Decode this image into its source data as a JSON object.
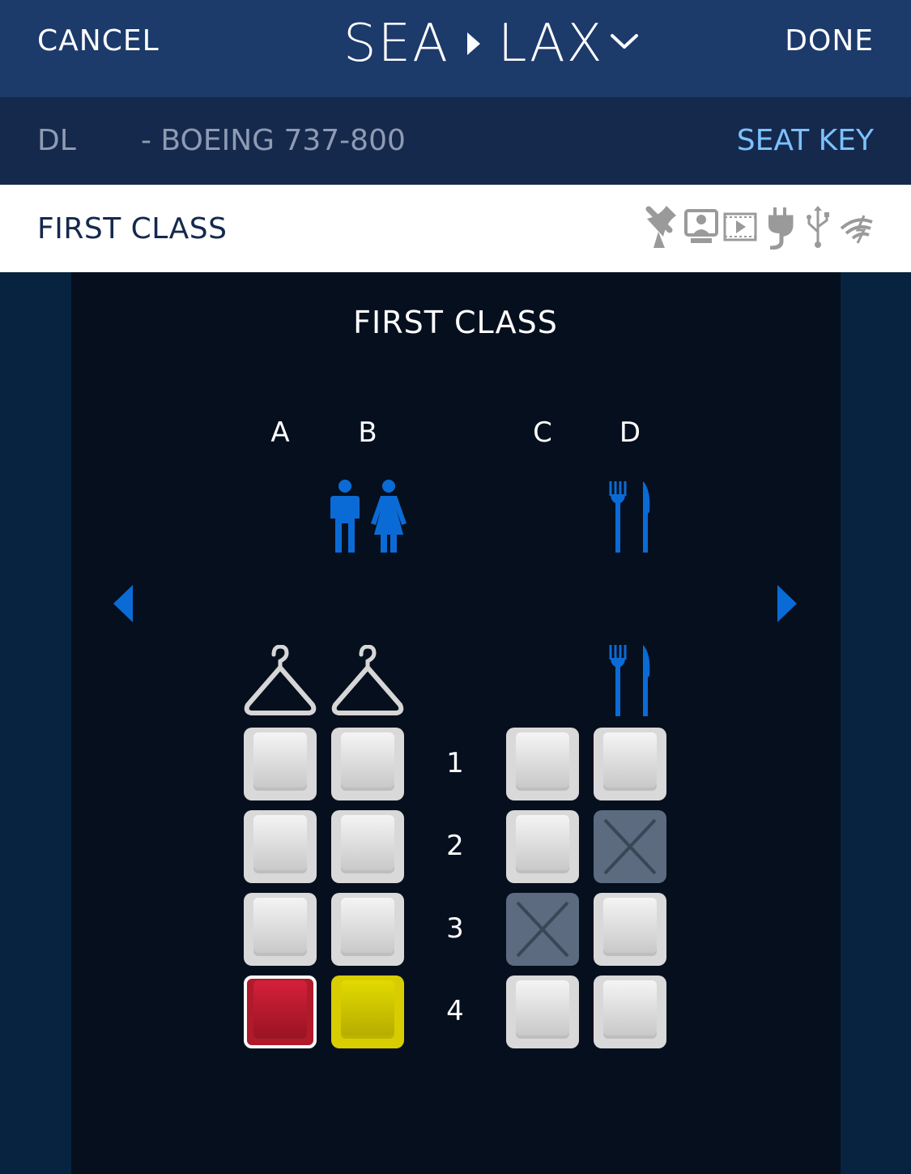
{
  "header": {
    "cancel_label": "CANCEL",
    "origin": "SEA",
    "destination": "LAX",
    "done_label": "DONE"
  },
  "aircraft": {
    "carrier": "DL",
    "model": "- BOEING 737-800",
    "seat_key_label": "SEAT KEY"
  },
  "cabin": {
    "name": "FIRST CLASS",
    "amenities": [
      "satellite-icon",
      "seatback-screen-icon",
      "film-icon",
      "power-plug-icon",
      "usb-icon",
      "wifi-icon"
    ]
  },
  "seatmap": {
    "title": "FIRST CLASS",
    "columns": [
      "A",
      "B",
      "C",
      "D"
    ],
    "facilities": [
      "lavatory-icon",
      "galley-icon",
      "closet-icon",
      "closet-icon",
      "galley-icon"
    ],
    "rows": [
      {
        "number": "1",
        "seats": [
          "available",
          "available",
          "available",
          "available"
        ]
      },
      {
        "number": "2",
        "seats": [
          "available",
          "available",
          "available",
          "occupied"
        ]
      },
      {
        "number": "3",
        "seats": [
          "available",
          "available",
          "occupied",
          "available"
        ]
      },
      {
        "number": "4",
        "seats": [
          "selected",
          "companion",
          "available",
          "available"
        ]
      }
    ]
  },
  "colors": {
    "header_bg": "#1c3a6a",
    "aircraft_bar_bg": "#15294d",
    "seat_key": "#7cc1ff",
    "map_bg": "#060f1e",
    "icon_blue": "#0b6bd6",
    "selected_seat": "#b01a2b",
    "companion_seat": "#d8cd00",
    "occupied_seat": "#5c6b80"
  }
}
